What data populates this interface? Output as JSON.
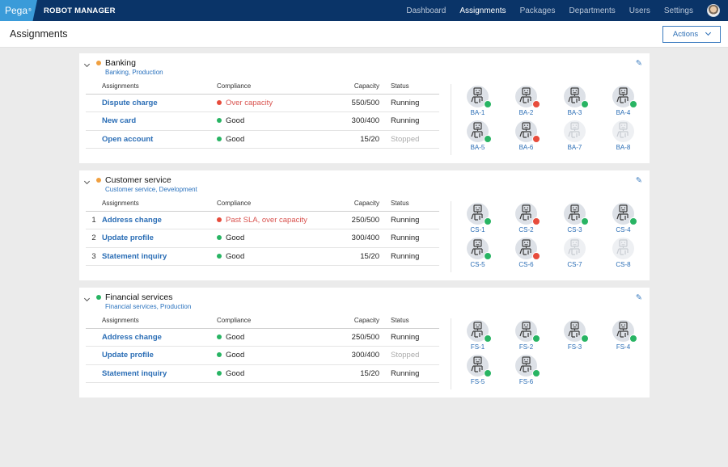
{
  "header": {
    "logo": "Pega",
    "app_name": "ROBOT MANAGER",
    "nav": [
      "Dashboard",
      "Assignments",
      "Packages",
      "Departments",
      "Users",
      "Settings"
    ],
    "active_nav": "Assignments"
  },
  "page": {
    "title": "Assignments",
    "actions_label": "Actions"
  },
  "colors": {
    "good": "#28b463",
    "bad": "#e74c3c",
    "warn": "#f0a040"
  },
  "columns": {
    "assignments": "Assignments",
    "compliance": "Compliance",
    "capacity": "Capacity",
    "status": "Status"
  },
  "departments": [
    {
      "name": "Banking",
      "subtitle": "Banking, Production",
      "state": "warn",
      "rows": [
        {
          "num": "",
          "name": "Dispute charge",
          "compliance": "Over capacity",
          "compliance_state": "bad",
          "capacity": "550/500",
          "status": "Running"
        },
        {
          "num": "",
          "name": "New card",
          "compliance": "Good",
          "compliance_state": "good",
          "capacity": "300/400",
          "status": "Running"
        },
        {
          "num": "",
          "name": "Open account",
          "compliance": "Good",
          "compliance_state": "good",
          "capacity": "15/20",
          "status": "Stopped"
        }
      ],
      "robots": [
        {
          "id": "BA-1",
          "state": "good"
        },
        {
          "id": "BA-2",
          "state": "bad"
        },
        {
          "id": "BA-3",
          "state": "good"
        },
        {
          "id": "BA-4",
          "state": "good"
        },
        {
          "id": "BA-5",
          "state": "good"
        },
        {
          "id": "BA-6",
          "state": "bad"
        },
        {
          "id": "BA-7",
          "state": "off"
        },
        {
          "id": "BA-8",
          "state": "off"
        }
      ]
    },
    {
      "name": "Customer service",
      "subtitle": "Customer service, Development",
      "state": "warn",
      "rows": [
        {
          "num": "1",
          "name": "Address change",
          "compliance": "Past SLA, over capacity",
          "compliance_state": "bad",
          "capacity": "250/500",
          "status": "Running"
        },
        {
          "num": "2",
          "name": "Update profile",
          "compliance": "Good",
          "compliance_state": "good",
          "capacity": "300/400",
          "status": "Running"
        },
        {
          "num": "3",
          "name": "Statement inquiry",
          "compliance": "Good",
          "compliance_state": "good",
          "capacity": "15/20",
          "status": "Running"
        }
      ],
      "robots": [
        {
          "id": "CS-1",
          "state": "good"
        },
        {
          "id": "CS-2",
          "state": "bad"
        },
        {
          "id": "CS-3",
          "state": "good"
        },
        {
          "id": "CS-4",
          "state": "good"
        },
        {
          "id": "CS-5",
          "state": "good"
        },
        {
          "id": "CS-6",
          "state": "bad"
        },
        {
          "id": "CS-7",
          "state": "off"
        },
        {
          "id": "CS-8",
          "state": "off"
        }
      ]
    },
    {
      "name": "Financial services",
      "subtitle": "Financial services, Production",
      "state": "good",
      "rows": [
        {
          "num": "",
          "name": "Address change",
          "compliance": "Good",
          "compliance_state": "good",
          "capacity": "250/500",
          "status": "Running"
        },
        {
          "num": "",
          "name": "Update profile",
          "compliance": "Good",
          "compliance_state": "good",
          "capacity": "300/400",
          "status": "Stopped"
        },
        {
          "num": "",
          "name": "Statement inquiry",
          "compliance": "Good",
          "compliance_state": "good",
          "capacity": "15/20",
          "status": "Running"
        }
      ],
      "robots": [
        {
          "id": "FS-1",
          "state": "good"
        },
        {
          "id": "FS-2",
          "state": "good"
        },
        {
          "id": "FS-3",
          "state": "good"
        },
        {
          "id": "FS-4",
          "state": "good"
        },
        {
          "id": "FS-5",
          "state": "good"
        },
        {
          "id": "FS-6",
          "state": "good"
        }
      ]
    }
  ]
}
